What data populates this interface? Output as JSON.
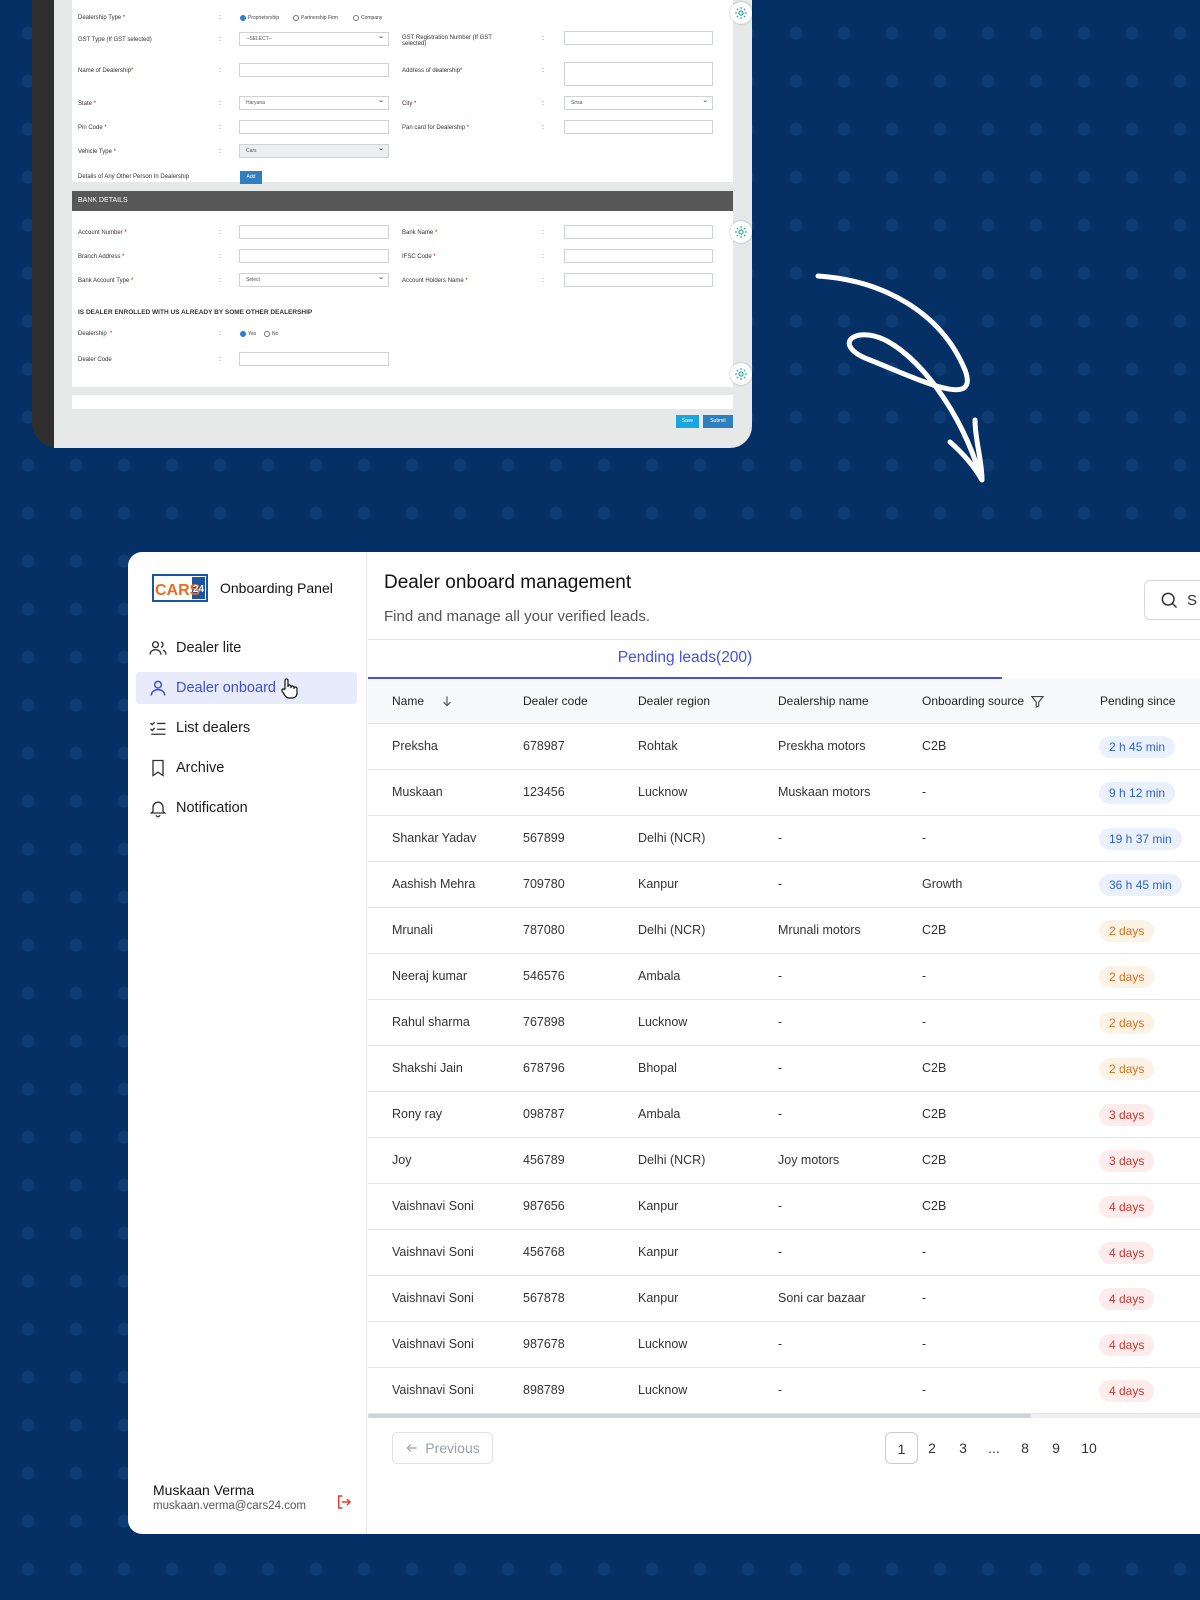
{
  "old_form": {
    "dealership_type_label": "Dealership Type",
    "radio_proprietorship": "Proprietorship",
    "radio_partnership": "Partnership Firm",
    "radio_company": "Company",
    "gst_type_label": "GST Type (If GST selected)",
    "gst_type_value": "--SELECT--",
    "gst_reg_label_1": "GST Registration Number (If GST",
    "gst_reg_label_2": "selected)",
    "name_label": "Name of Dealership",
    "address_label": "Address of dealership",
    "state_label": "State",
    "state_value": "Haryana",
    "city_label": "City",
    "city_value": "Sirsa",
    "pin_label": "Pin Code",
    "pan_label": "Pan card for Dealership",
    "vehicle_label": "Vehicle Type",
    "vehicle_value": "Cars",
    "other_person_label": "Details of Any Other Person In Dealership",
    "add_label": "Add",
    "bank_header": "BANK DETAILS",
    "account_number_label": "Account Number",
    "bank_name_label": "Bank Name",
    "branch_label": "Branch Address",
    "ifsc_label": "IFSC Code",
    "account_type_label": "Bank Account Type",
    "account_type_value": "Select",
    "holder_label": "Account Holders Name",
    "enrolled_heading": "IS DEALER ENROLLED WITH US ALREADY BY SOME OTHER DEALERSHIP",
    "dealership_label": "Dealership",
    "radio_yes": "Yes",
    "radio_no": "No",
    "dealer_code_label": "Dealer Code",
    "save_label": "Save",
    "submit_label": "Submit",
    "colon": ":",
    "required_mark": "*"
  },
  "sidebar": {
    "logo_text": "CARS",
    "logo_number": "24",
    "brand": "Onboarding Panel",
    "items": [
      {
        "label": "Dealer lite",
        "icon": "users-icon"
      },
      {
        "label": "Dealer onboard",
        "icon": "user-icon"
      },
      {
        "label": "List dealers",
        "icon": "checklist-icon"
      },
      {
        "label": "Archive",
        "icon": "bookmark-icon"
      },
      {
        "label": "Notification",
        "icon": "bell-icon"
      }
    ],
    "active_index": 1,
    "user_name": "Muskaan Verma",
    "user_email": "muskaan.verma@cars24.com"
  },
  "header": {
    "title": "Dealer onboard management",
    "subtitle": "Find and manage all your verified leads.",
    "search_text": "S"
  },
  "tab": {
    "label": "Pending leads(200)"
  },
  "table": {
    "columns": [
      "Name",
      "Dealer code",
      "Dealer region",
      "Dealership name",
      "Onboarding source",
      "Pending since"
    ],
    "rows": [
      {
        "name": "Preksha",
        "code": "678987",
        "region": "Rohtak",
        "dealership": "Preskha motors",
        "source": "C2B",
        "pending": "2 h 45 min",
        "tone": "blue"
      },
      {
        "name": "Muskaan",
        "code": "123456",
        "region": "Lucknow",
        "dealership": "Muskaan motors",
        "source": "-",
        "pending": "9 h 12 min",
        "tone": "blue"
      },
      {
        "name": "Shankar Yadav",
        "code": "567899",
        "region": "Delhi (NCR)",
        "dealership": "-",
        "source": "-",
        "pending": "19 h 37 min",
        "tone": "blue"
      },
      {
        "name": "Aashish Mehra",
        "code": "709780",
        "region": "Kanpur",
        "dealership": "-",
        "source": "Growth",
        "pending": "36 h 45 min",
        "tone": "blue"
      },
      {
        "name": "Mrunali",
        "code": "787080",
        "region": "Delhi (NCR)",
        "dealership": "Mrunali motors",
        "source": "C2B",
        "pending": "2 days",
        "tone": "orange"
      },
      {
        "name": "Neeraj kumar",
        "code": "546576",
        "region": "Ambala",
        "dealership": "-",
        "source": "-",
        "pending": "2 days",
        "tone": "orange"
      },
      {
        "name": "Rahul sharma",
        "code": "767898",
        "region": "Lucknow",
        "dealership": "-",
        "source": "-",
        "pending": "2 days",
        "tone": "orange"
      },
      {
        "name": "Shakshi Jain",
        "code": "678796",
        "region": "Bhopal",
        "dealership": "-",
        "source": "C2B",
        "pending": "2 days",
        "tone": "orange"
      },
      {
        "name": "Rony ray",
        "code": "098787",
        "region": "Ambala",
        "dealership": "-",
        "source": "C2B",
        "pending": "3 days",
        "tone": "red"
      },
      {
        "name": "Joy",
        "code": "456789",
        "region": "Delhi (NCR)",
        "dealership": "Joy motors",
        "source": "C2B",
        "pending": "3 days",
        "tone": "red"
      },
      {
        "name": "Vaishnavi Soni",
        "code": "987656",
        "region": "Kanpur",
        "dealership": "-",
        "source": "C2B",
        "pending": "4 days",
        "tone": "red"
      },
      {
        "name": "Vaishnavi Soni",
        "code": "456768",
        "region": "Kanpur",
        "dealership": "-",
        "source": "-",
        "pending": "4 days",
        "tone": "red"
      },
      {
        "name": "Vaishnavi Soni",
        "code": "567878",
        "region": "Kanpur",
        "dealership": "Soni car bazaar",
        "source": "-",
        "pending": "4 days",
        "tone": "red"
      },
      {
        "name": "Vaishnavi Soni",
        "code": "987678",
        "region": "Lucknow",
        "dealership": "-",
        "source": "-",
        "pending": "4 days",
        "tone": "red"
      },
      {
        "name": "Vaishnavi Soni",
        "code": "898789",
        "region": "Lucknow",
        "dealership": "-",
        "source": "-",
        "pending": "4 days",
        "tone": "red"
      }
    ]
  },
  "pagination": {
    "previous_label": "Previous",
    "pages": [
      "1",
      "2",
      "3",
      "...",
      "8",
      "9",
      "10"
    ],
    "current": "1"
  },
  "colors": {
    "background": "#053066",
    "accent": "#4552d9",
    "logo_orange": "#ef6c1a",
    "logo_blue": "#1b56a6",
    "logout_red": "#e0402f"
  }
}
